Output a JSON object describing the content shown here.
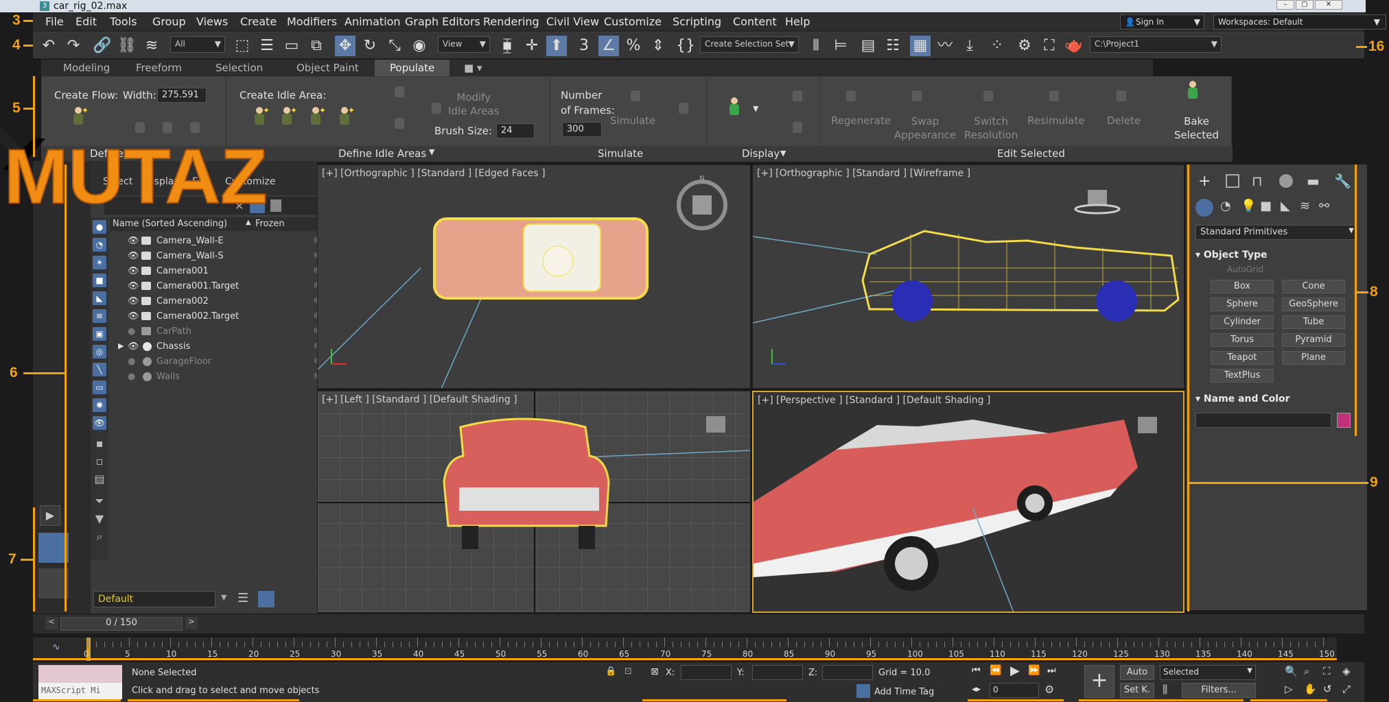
{
  "window": {
    "title": "car_rig_02.max"
  },
  "menu": [
    "File",
    "Edit",
    "Tools",
    "Group",
    "Views",
    "Create",
    "Modifiers",
    "Animation",
    "Graph Editors",
    "Rendering",
    "Civil View",
    "Customize",
    "Scripting",
    "Content",
    "Help"
  ],
  "account": {
    "sign_in": "Sign In",
    "workspace": "Workspaces: Default"
  },
  "toolbar": {
    "filter": "All",
    "ref_coord": "View",
    "selection_set": "Create Selection Set",
    "project_path": "C:\\Project1"
  },
  "ribbon_tabs": [
    "Modeling",
    "Freeform",
    "Selection",
    "Object Paint",
    "Populate"
  ],
  "ribbon": {
    "create_flow": "Create Flow:",
    "width_label": "Width:",
    "width_value": "275.591",
    "create_idle": "Create Idle Area:",
    "modify_idle": "Modify\nIdle Areas",
    "brush_label": "Brush Size:",
    "brush_value": "24",
    "num_frames": "Number\nof Frames:",
    "frames_value": "300",
    "simulate": "Simulate",
    "regenerate": "Regenerate",
    "swap": "Swap\nAppearance",
    "switch": "Switch\nResolution",
    "resimulate": "Resimulate",
    "delete": "Delete",
    "bake": "Bake\nSelected",
    "groups": {
      "define_idle": "Define Idle Areas",
      "simulate": "Simulate",
      "display": "Display",
      "edit_selected": "Edit Selected",
      "define_flow": "Define Flow"
    }
  },
  "logo": "MUTAZ",
  "scene_explorer": {
    "tabs": [
      "Select",
      "Display",
      "Edit",
      "Customize"
    ],
    "column_name": "Name (Sorted Ascending)",
    "column_frozen": "Frozen",
    "items": [
      {
        "name": "Camera_Wall-E",
        "type": "camera"
      },
      {
        "name": "Camera_Wall-S",
        "type": "camera"
      },
      {
        "name": "Camera001",
        "type": "camera"
      },
      {
        "name": "Camera001.Target",
        "type": "camera"
      },
      {
        "name": "Camera002",
        "type": "camera"
      },
      {
        "name": "Camera002.Target",
        "type": "camera"
      },
      {
        "name": "CarPath",
        "type": "shape"
      },
      {
        "name": "Chassis",
        "type": "geometry"
      },
      {
        "name": "GarageFloor",
        "type": "geometry"
      },
      {
        "name": "Walls",
        "type": "geometry"
      }
    ],
    "layer": "Default"
  },
  "viewports": {
    "top": "[+] [Orthographic ] [Standard ] [Edged Faces ]",
    "front": "[+] [Orthographic ] [Standard ] [Wireframe ]",
    "left": "[+] [Left ] [Standard ] [Default Shading ]",
    "persp": "[+] [Perspective ] [Standard ] [Default Shading ]"
  },
  "command_panel": {
    "category": "Standard Primitives",
    "object_type": "Object Type",
    "autogrid": "AutoGrid",
    "buttons": [
      "Box",
      "Cone",
      "Sphere",
      "GeoSphere",
      "Cylinder",
      "Tube",
      "Torus",
      "Pyramid",
      "Teapot",
      "Plane",
      "TextPlus"
    ],
    "name_color": "Name and Color",
    "swatch": "#c2307a"
  },
  "timeline": {
    "frame": "0 / 150",
    "ticks": [
      0,
      5,
      10,
      15,
      20,
      25,
      30,
      35,
      40,
      45,
      50,
      55,
      60,
      65,
      70,
      75,
      80,
      85,
      90,
      95,
      100,
      105,
      110,
      115,
      120,
      125,
      130,
      135,
      140,
      145,
      150
    ]
  },
  "status": {
    "maxscript": "MAXScript Mi",
    "selected": "None Selected",
    "prompt": "Click and drag to select and move objects",
    "x": "X:",
    "y": "Y:",
    "z": "Z:",
    "grid": "Grid = 10.0",
    "add_time_tag": "Add Time Tag",
    "frame_field": "0",
    "auto": "Auto",
    "setk": "Set K.",
    "key_mode": "Selected",
    "filters": "Filters..."
  },
  "callouts": [
    "3",
    "4",
    "5",
    "6",
    "7",
    "8",
    "9",
    "16"
  ],
  "accent": "#f5a20a"
}
